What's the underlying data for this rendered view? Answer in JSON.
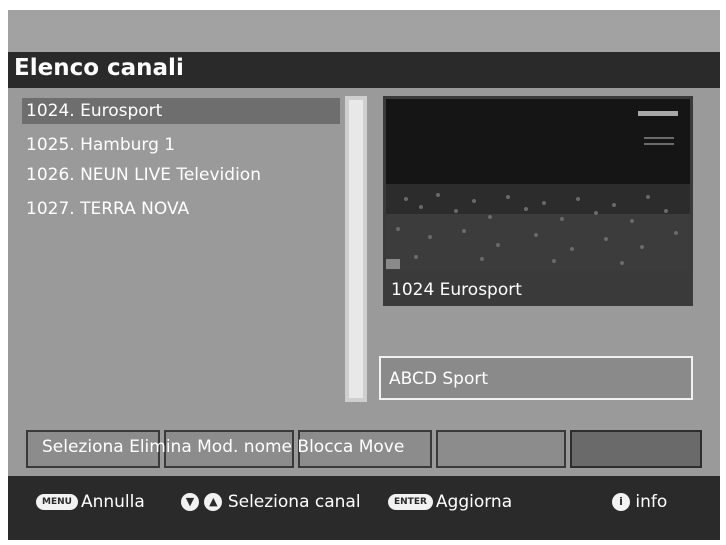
{
  "header": {
    "title": "Elenco canali"
  },
  "channels": [
    {
      "label": "1024. Eurosport",
      "selected": true
    },
    {
      "label": "1025. Hamburg 1",
      "selected": false
    },
    {
      "label": "1026. NEUN LIVE Televidion",
      "selected": false
    },
    {
      "label": "1027. TERRA NOVA",
      "selected": false
    }
  ],
  "preview": {
    "channel_label": "1024 Eurosport"
  },
  "info_box": {
    "text": "ABCD Sport"
  },
  "function_bar": {
    "text": "Seleziona Elimina Mod. nome Blocca Move"
  },
  "hints": {
    "menu_key": "MENU",
    "menu_label": "Annulla",
    "nav_label": "Seleziona canal",
    "enter_key": "ENTER",
    "enter_label": "Aggiorna",
    "info_key": "i",
    "info_label": "info"
  },
  "colors": {
    "background": "#9a9a9a",
    "bar": "#2a2a2a",
    "selection": "#6e6e6e"
  }
}
